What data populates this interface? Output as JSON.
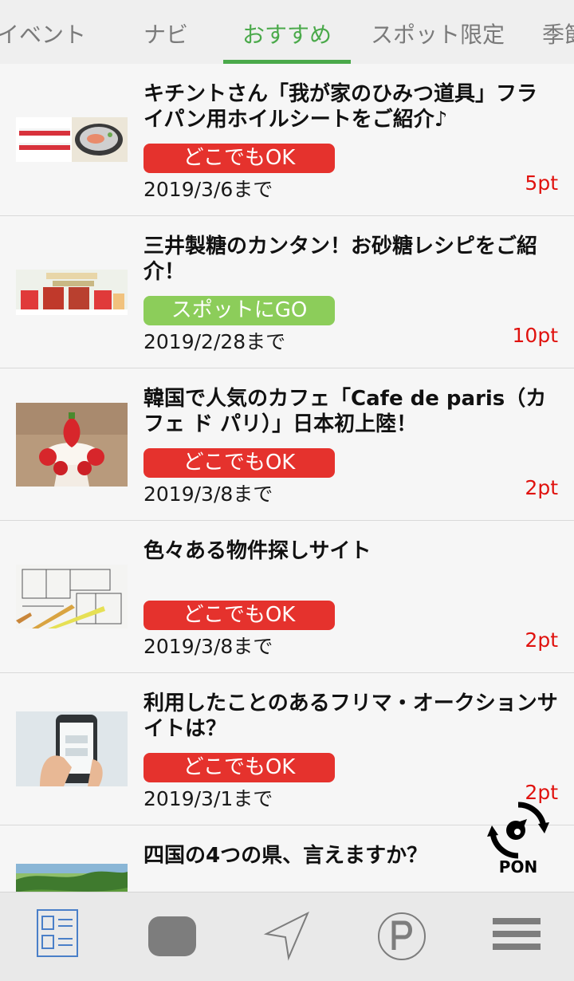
{
  "tabs": [
    {
      "label": "イベント",
      "active": false
    },
    {
      "label": "ナビ",
      "active": false
    },
    {
      "label": "おすすめ",
      "active": true
    },
    {
      "label": "スポット限定",
      "active": false
    },
    {
      "label": "季節",
      "active": false
    }
  ],
  "items": [
    {
      "title": "キチントさん「我が家のひみつ道具」フライパン用ホイルシートをご紹介♪",
      "badge": "どこでもOK",
      "badge_color": "#e5322d",
      "deadline": "2019/3/6まで",
      "points": "5pt",
      "thumbnail": "foil-sheet-photo"
    },
    {
      "title": "三井製糖のカンタン！お砂糖レシピをご紹介！",
      "badge": "スポットにGO",
      "badge_color": "#8ccd5a",
      "deadline": "2019/2/28まで",
      "points": "10pt",
      "thumbnail": "sugar-products-photo"
    },
    {
      "title": "韓国で人気のカフェ「Cafe de paris（カフェ ド パリ）」日本初上陸！",
      "badge": "どこでもOK",
      "badge_color": "#e5322d",
      "deadline": "2019/3/8まで",
      "points": "2pt",
      "thumbnail": "strawberry-parfait-photo"
    },
    {
      "title": "色々ある物件探しサイト",
      "badge": "どこでもOK",
      "badge_color": "#e5322d",
      "deadline": "2019/3/8まで",
      "points": "2pt",
      "thumbnail": "floor-plan-photo"
    },
    {
      "title": "利用したことのあるフリマ・オークションサイトは？",
      "badge": "どこでもOK",
      "badge_color": "#e5322d",
      "deadline": "2019/3/1まで",
      "points": "2pt",
      "thumbnail": "smartphone-hand-photo"
    },
    {
      "title": "四国の4つの県、言えますか？",
      "thumbnail": "landscape-photo"
    }
  ],
  "pon_button": {
    "label": "PON"
  },
  "bottom_nav": [
    "list-icon",
    "chat-bubble-icon",
    "navigation-arrow-icon",
    "points-icon",
    "menu-icon"
  ],
  "colors": {
    "accent_green": "#4aa94a",
    "badge_red": "#e5322d",
    "badge_green": "#8ccd5a",
    "points_red": "#e0120e"
  }
}
